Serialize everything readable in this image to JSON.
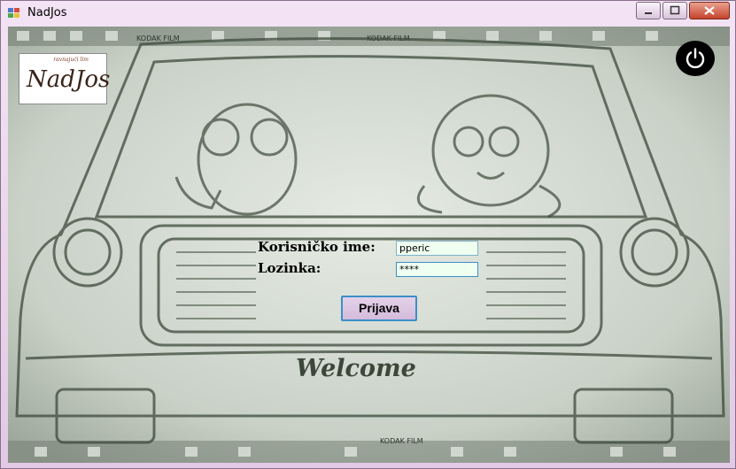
{
  "window": {
    "title": "NadJos",
    "controls": [
      "minimize",
      "maximize",
      "close"
    ]
  },
  "logo": {
    "text": "NadJos",
    "subtitle": "ravnajući lim"
  },
  "power_button": {
    "icon": "power-icon"
  },
  "background": {
    "welcome_text": "Welcome",
    "film_text": "KODAK FILM"
  },
  "form": {
    "username_label": "Korisničko ime:",
    "username_value": "pperic",
    "password_label": "Lozinka:",
    "password_value": "****",
    "submit_label": "Prijava"
  },
  "colors": {
    "input_bg": "#effff0",
    "button_border": "#3c8fc8",
    "window_frame": "#e9d6ea"
  }
}
